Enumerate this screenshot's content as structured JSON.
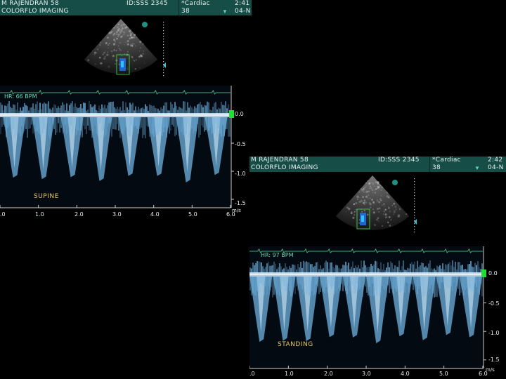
{
  "panel1": {
    "name": "M RAJENDRAN 58",
    "mode": "COLORFLO  IMAGING",
    "id": "ID:SSS 2345",
    "preset": "*Cardiac",
    "preset_num": "38",
    "time": "2:41",
    "date": "04-N",
    "hr": "HR: 66 BPM",
    "position": "SUPINE",
    "y_ticks": [
      "0.0",
      "-0.5",
      "-1.0",
      "-1.5"
    ],
    "x_ticks": [
      ".0",
      "1.0",
      "2.0",
      "3.0",
      "4.0",
      "5.0",
      "6.0"
    ],
    "x_unit": "m/s",
    "beats_per_6s": 8
  },
  "panel2": {
    "name": "M RAJENDRAN 58",
    "mode": "COLORFLO  IMAGING",
    "id": "ID:SSS 2345",
    "preset": "*Cardiac",
    "preset_num": "38",
    "time": "2:42",
    "date": "04-N",
    "hr": "HR: 97 BPM",
    "position": "STANDING",
    "y_ticks": [
      "0.0",
      "-0.5",
      "-1.0",
      "-1.5"
    ],
    "x_ticks": [
      ".0",
      "1.0",
      "2.0",
      "3.0",
      "4.0",
      "5.0",
      "6.0"
    ],
    "x_unit": "m/s",
    "beats_per_6s": 10
  },
  "colors": {
    "header_bg": "#174d47",
    "doppler": "#6fb2e0",
    "doppler_bright": "#d8f0ff",
    "ecg": "#3fae7a",
    "label": "#e6c85a",
    "marker": "#22dd33"
  }
}
